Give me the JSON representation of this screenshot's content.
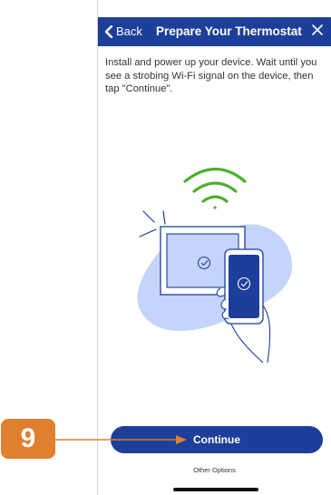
{
  "header": {
    "back_label": "Back",
    "title": "Prepare Your Thermostat"
  },
  "instructions": "Install and power up your device. Wait until you see a strobing Wi-Fi signal on the device, then tap \"Continue\".",
  "actions": {
    "continue_label": "Continue",
    "other_options_label": "Other Options"
  },
  "annotation": {
    "step_number": "9"
  },
  "colors": {
    "brand_blue": "#1d3f9a",
    "wifi_green": "#4caf2e",
    "callout_orange": "#e07f2e",
    "blob_blue": "#c4d4fb"
  },
  "icons": [
    "chevron-left-icon",
    "close-icon",
    "wifi-icon",
    "check-circle-icon"
  ]
}
